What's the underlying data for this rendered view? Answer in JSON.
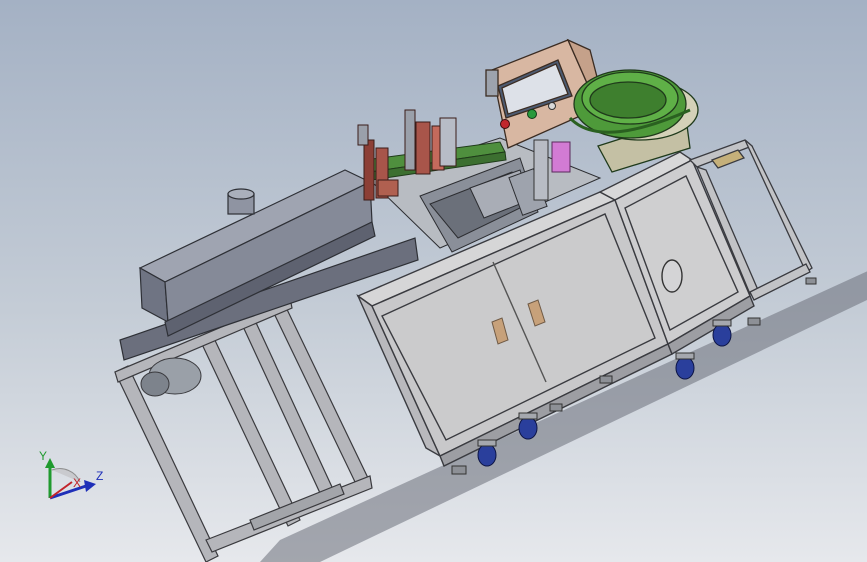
{
  "triad": {
    "y_label": "Y",
    "x_label": "X",
    "z_label": "Z"
  },
  "colors": {
    "frame": "#b9b9bd",
    "panel": "#cfcfd0",
    "conveyor": "#7e8494",
    "screen": "#dde1e8",
    "control_box": "#d8b7a2",
    "bowl": "#4e9a3a",
    "caster": "#2a3f9c",
    "handle": "#c7a17a"
  }
}
